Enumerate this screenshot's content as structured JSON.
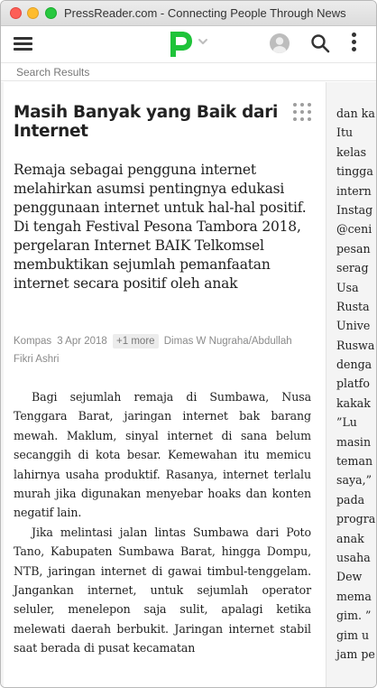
{
  "window": {
    "title": "PressReader.com - Connecting People Through News"
  },
  "toolbar": {
    "brand_color": "#1fc33a",
    "icons": [
      "menu-icon",
      "pressreader-logo",
      "chevron-down-icon",
      "user-avatar-icon",
      "search-icon",
      "more-vert-icon"
    ]
  },
  "breadcrumb": {
    "label": "Search Results"
  },
  "article": {
    "headline": "Masih Banyak yang Baik dari Internet",
    "lede": "Remaja sebagai pengguna internet melahirkan asumsi pentingnya edukasi penggunaan internet untuk hal-hal positif. Di tengah Festival Pesona Tambora 2018, pergelaran Internet BAIK Telkomsel membuktikan sejumlah pemanfaatan internet secara positif oleh anak",
    "source": "Kompas",
    "date": "3 Apr 2018",
    "more_label": "+1 more",
    "authors": "Dimas W Nugraha/Abdullah Fikri Ashri",
    "paragraphs": [
      "Bagi sejumlah remaja di Sumbawa, Nusa Tenggara Barat, jaringan internet bak barang mewah. Maklum, sinyal internet di sana belum secanggih di kota besar. Kemewahan itu memicu lahirnya usaha produktif. Rasanya, internet terlalu murah jika digunakan menyebar hoaks dan konten negatif lain.",
      "Jika melintasi jalan lintas Sumbawa dari Poto Tano, Kabupaten Sumbawa Barat, hingga Dompu, NTB, jaringan internet di gawai timbul-tenggelam. Jangankan internet, untuk sejumlah operator seluler, menelepon saja sulit, apalagi ketika melewati daerah berbukit. Jaringan internet stabil saat berada di pusat kecamatan"
    ],
    "next_column_lines": [
      "dan ka",
      "Itu",
      "kelas",
      "tingga",
      "intern",
      "Instag",
      "@ceni",
      "pesan",
      "serag",
      "Usa",
      "Rusta",
      "Unive",
      "Ruswa",
      "denga",
      "platfo",
      "kakak",
      "”Lu",
      "masin",
      "teman",
      "saya,”",
      "pada",
      "progra",
      "anak",
      "usaha",
      "Dew",
      "mema",
      "gim. ”",
      "gim u",
      "jam pe"
    ]
  }
}
